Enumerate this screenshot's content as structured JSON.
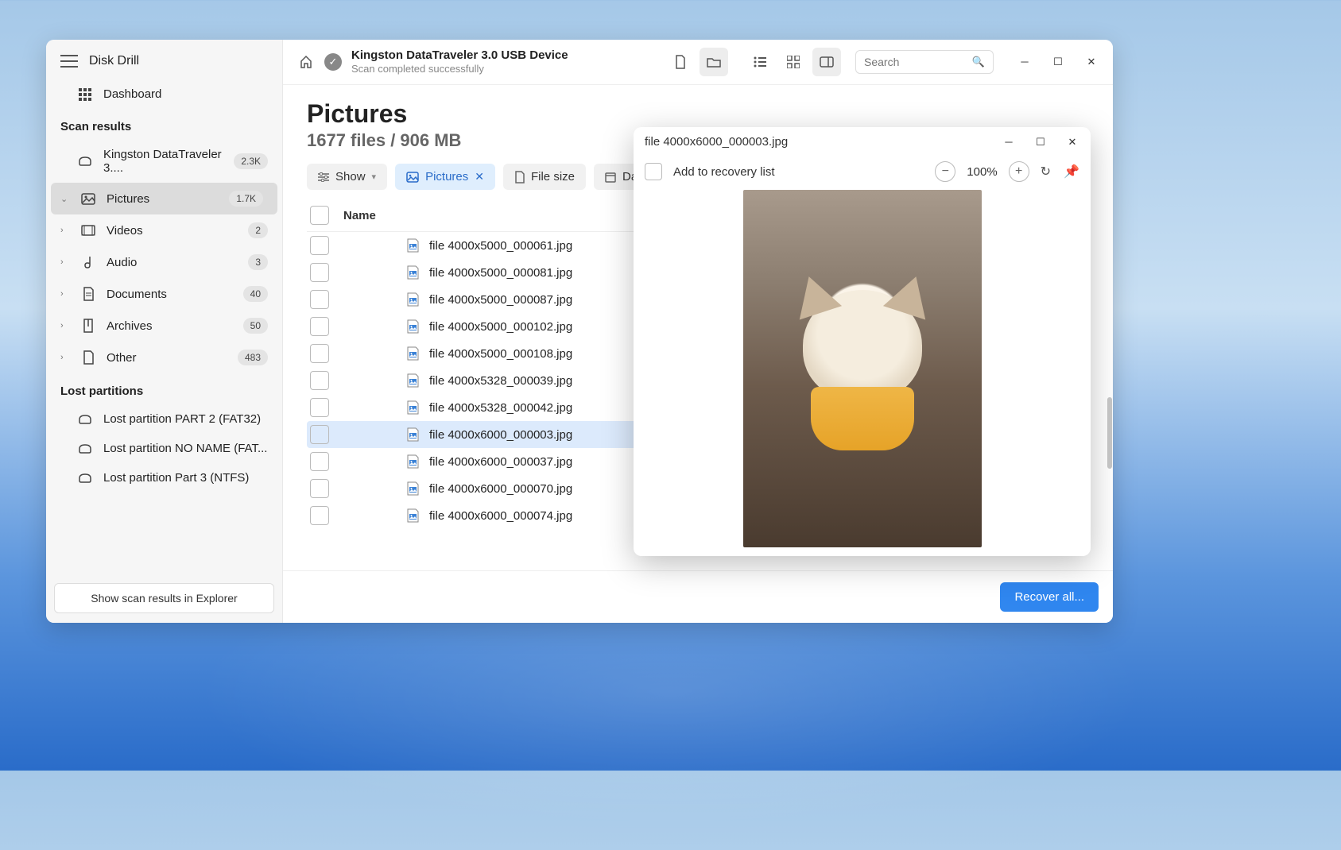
{
  "app_title": "Disk Drill",
  "sidebar": {
    "dashboard_label": "Dashboard",
    "section_scan": "Scan results",
    "section_lost": "Lost partitions",
    "device": {
      "label": "Kingston DataTraveler 3....",
      "count": "2.3K"
    },
    "categories": [
      {
        "label": "Pictures",
        "count": "1.7K",
        "active": true
      },
      {
        "label": "Videos",
        "count": "2"
      },
      {
        "label": "Audio",
        "count": "3"
      },
      {
        "label": "Documents",
        "count": "40"
      },
      {
        "label": "Archives",
        "count": "50"
      },
      {
        "label": "Other",
        "count": "483"
      }
    ],
    "lost": [
      {
        "label": "Lost partition PART 2 (FAT32)"
      },
      {
        "label": "Lost partition NO NAME (FAT..."
      },
      {
        "label": "Lost partition Part 3 (NTFS)"
      }
    ],
    "explorer_btn": "Show scan results in Explorer"
  },
  "header": {
    "title": "Kingston DataTraveler 3.0 USB Device",
    "subtitle": "Scan completed successfully",
    "search_placeholder": "Search"
  },
  "content": {
    "title": "Pictures",
    "subtitle": "1677 files / 906 MB",
    "filters": {
      "show": "Show",
      "pictures": "Pictures",
      "filesize": "File size",
      "date_prefix": "Da"
    },
    "col_name": "Name",
    "files": [
      "file 4000x5000_000061.jpg",
      "file 4000x5000_000081.jpg",
      "file 4000x5000_000087.jpg",
      "file 4000x5000_000102.jpg",
      "file 4000x5000_000108.jpg",
      "file 4000x5328_000039.jpg",
      "file 4000x5328_000042.jpg",
      "file 4000x6000_000003.jpg",
      "file 4000x6000_000037.jpg",
      "file 4000x6000_000070.jpg",
      "file 4000x6000_000074.jpg"
    ],
    "selected_index": 7
  },
  "preview": {
    "title": "file 4000x6000_000003.jpg",
    "add_label": "Add to recovery list",
    "zoom": "100%"
  },
  "footer": {
    "recover": "Recover all..."
  }
}
